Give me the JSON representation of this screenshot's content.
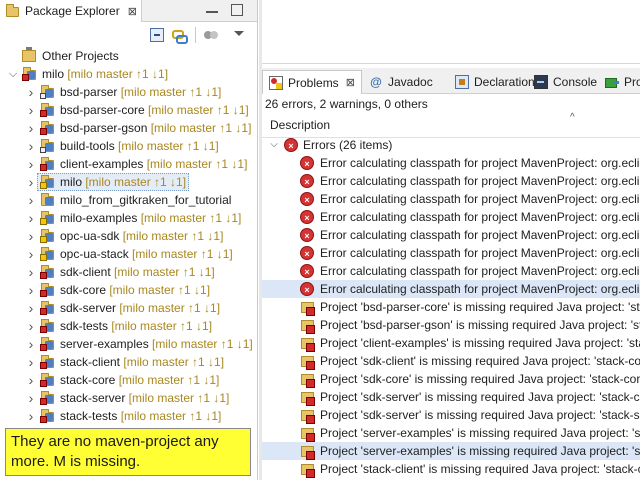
{
  "package_explorer": {
    "tab_title": "Package Explorer",
    "close_glyph": "⊠",
    "tree": [
      {
        "name": "Other Projects",
        "deco": "",
        "level": 0,
        "expanded": null,
        "icon": "workspace-root",
        "overlay": "none"
      },
      {
        "name": "milo",
        "deco": " [milo master ↑1 ↓1]",
        "level": 0,
        "expanded": true,
        "icon": "project",
        "overlay": "error"
      },
      {
        "name": "bsd-parser",
        "deco": " [milo master ↑1 ↓1]",
        "level": 1,
        "expanded": false,
        "icon": "project",
        "overlay": "git"
      },
      {
        "name": "bsd-parser-core",
        "deco": " [milo master ↑1 ↓1]",
        "level": 1,
        "expanded": false,
        "icon": "project",
        "overlay": "error"
      },
      {
        "name": "bsd-parser-gson",
        "deco": " [milo master ↑1 ↓1]",
        "level": 1,
        "expanded": false,
        "icon": "project",
        "overlay": "error"
      },
      {
        "name": "build-tools",
        "deco": " [milo master ↑1 ↓1]",
        "level": 1,
        "expanded": false,
        "icon": "project",
        "overlay": "git"
      },
      {
        "name": "client-examples",
        "deco": " [milo master ↑1 ↓1]",
        "level": 1,
        "expanded": false,
        "icon": "project",
        "overlay": "error"
      },
      {
        "name": "milo",
        "deco": " [milo master ↑1 ↓1]",
        "level": 1,
        "expanded": false,
        "icon": "project",
        "overlay": "warning",
        "selected": true
      },
      {
        "name": "milo_from_gitkraken_for_tutorial",
        "deco": "",
        "level": 1,
        "expanded": false,
        "icon": "project",
        "overlay": "none"
      },
      {
        "name": "milo-examples",
        "deco": " [milo master ↑1 ↓1]",
        "level": 1,
        "expanded": false,
        "icon": "project",
        "overlay": "warning"
      },
      {
        "name": "opc-ua-sdk",
        "deco": " [milo master ↑1 ↓1]",
        "level": 1,
        "expanded": false,
        "icon": "project",
        "overlay": "warning"
      },
      {
        "name": "opc-ua-stack",
        "deco": " [milo master ↑1 ↓1]",
        "level": 1,
        "expanded": false,
        "icon": "project",
        "overlay": "warning"
      },
      {
        "name": "sdk-client",
        "deco": " [milo master ↑1 ↓1]",
        "level": 1,
        "expanded": false,
        "icon": "project",
        "overlay": "error"
      },
      {
        "name": "sdk-core",
        "deco": " [milo master ↑1 ↓1]",
        "level": 1,
        "expanded": false,
        "icon": "project",
        "overlay": "error"
      },
      {
        "name": "sdk-server",
        "deco": " [milo master ↑1 ↓1]",
        "level": 1,
        "expanded": false,
        "icon": "project",
        "overlay": "error"
      },
      {
        "name": "sdk-tests",
        "deco": " [milo master ↑1 ↓1]",
        "level": 1,
        "expanded": false,
        "icon": "project",
        "overlay": "error"
      },
      {
        "name": "server-examples",
        "deco": " [milo master ↑1 ↓1]",
        "level": 1,
        "expanded": false,
        "icon": "project",
        "overlay": "error"
      },
      {
        "name": "stack-client",
        "deco": " [milo master ↑1 ↓1]",
        "level": 1,
        "expanded": false,
        "icon": "project",
        "overlay": "error"
      },
      {
        "name": "stack-core",
        "deco": " [milo master ↑1 ↓1]",
        "level": 1,
        "expanded": false,
        "icon": "project",
        "overlay": "error"
      },
      {
        "name": "stack-server",
        "deco": " [milo master ↑1 ↓1]",
        "level": 1,
        "expanded": false,
        "icon": "project",
        "overlay": "error"
      },
      {
        "name": "stack-tests",
        "deco": " [milo master ↑1 ↓1]",
        "level": 1,
        "expanded": false,
        "icon": "project",
        "overlay": "error"
      }
    ]
  },
  "annotation": {
    "text": "They are no maven-project any more. M is missing."
  },
  "bottom_panel": {
    "tabs": [
      {
        "label": "Problems",
        "icon": "problems-icon",
        "active": true
      },
      {
        "label": "Javadoc",
        "icon": "javadoc-icon",
        "active": false
      },
      {
        "label": "Declaration",
        "icon": "declaration-icon",
        "active": false
      },
      {
        "label": "Console",
        "icon": "console-icon",
        "active": false
      },
      {
        "label": "Progr",
        "icon": "progress-icon",
        "active": false
      }
    ],
    "close_glyph": "⊠",
    "javadoc_glyph": "@",
    "summary": "26 errors, 2 warnings, 0 others",
    "column_header": "Description",
    "sort_glyph": "^",
    "group_label": "Errors (26 items)",
    "rows": [
      {
        "text": "Error calculating classpath for project MavenProject: org.eclip",
        "type": "error"
      },
      {
        "text": "Error calculating classpath for project MavenProject: org.eclip",
        "type": "error"
      },
      {
        "text": "Error calculating classpath for project MavenProject: org.eclip",
        "type": "error"
      },
      {
        "text": "Error calculating classpath for project MavenProject: org.eclip",
        "type": "error"
      },
      {
        "text": "Error calculating classpath for project MavenProject: org.eclip",
        "type": "error"
      },
      {
        "text": "Error calculating classpath for project MavenProject: org.eclip",
        "type": "error"
      },
      {
        "text": "Error calculating classpath for project MavenProject: org.eclip",
        "type": "error"
      },
      {
        "text": "Error calculating classpath for project MavenProject: org.eclip",
        "type": "error",
        "selected": true
      },
      {
        "text": "Project 'bsd-parser-core' is missing required Java project: 'sta",
        "type": "project-error"
      },
      {
        "text": "Project 'bsd-parser-gson' is missing required Java project: 'sta",
        "type": "project-error"
      },
      {
        "text": "Project 'client-examples' is missing required Java project: 'sta",
        "type": "project-error"
      },
      {
        "text": "Project 'sdk-client' is missing required Java project: 'stack-co",
        "type": "project-error"
      },
      {
        "text": "Project 'sdk-core' is missing required Java project: 'stack-core",
        "type": "project-error"
      },
      {
        "text": "Project 'sdk-server' is missing required Java project: 'stack-co",
        "type": "project-error"
      },
      {
        "text": "Project 'sdk-server' is missing required Java project: 'stack-se",
        "type": "project-error"
      },
      {
        "text": "Project 'server-examples' is missing required Java project: 'sta",
        "type": "project-error"
      },
      {
        "text": "Project 'server-examples' is missing required Java project: 'sta",
        "type": "project-error",
        "selected": true
      },
      {
        "text": "Project 'stack-client' is missing required Java project: 'stack-c",
        "type": "project-error"
      }
    ]
  }
}
